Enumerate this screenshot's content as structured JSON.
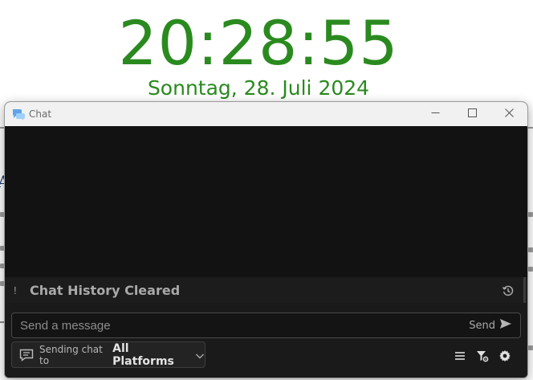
{
  "clock": {
    "time": "20:28:55",
    "date": "Sonntag, 28. Juli 2024"
  },
  "window": {
    "title": "Chat",
    "icon": "chat-bubbles-icon"
  },
  "window_controls": [
    "minimize-icon",
    "maximize-icon",
    "close-icon"
  ],
  "chat": {
    "system_marker": "!",
    "system_message": "Chat History Cleared",
    "history_icon": "history-icon"
  },
  "composer": {
    "placeholder": "Send a message",
    "send_label": "Send",
    "target_prefix": "Sending chat to",
    "target_value": "All Platforms"
  },
  "toolbar_icons": [
    "list-icon",
    "filter-settings-icon",
    "gear-icon"
  ],
  "colors": {
    "clock": "#2a8a1f",
    "chat_bg": "#141414",
    "titlebar": "#f1f1f1"
  }
}
